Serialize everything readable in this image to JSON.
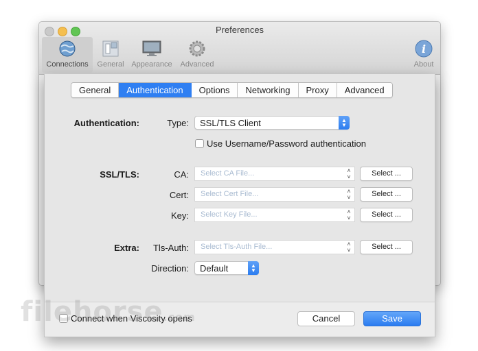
{
  "window": {
    "title": "Preferences"
  },
  "toolbar": {
    "items": [
      {
        "label": "Connections",
        "icon": "globe-network-icon"
      },
      {
        "label": "General",
        "icon": "light-switch-icon"
      },
      {
        "label": "Appearance",
        "icon": "monitor-icon"
      },
      {
        "label": "Advanced",
        "icon": "gear-icon"
      },
      {
        "label": "About",
        "icon": "info-icon"
      }
    ]
  },
  "tabs": [
    "General",
    "Authentication",
    "Options",
    "Networking",
    "Proxy",
    "Advanced"
  ],
  "active_tab": "Authentication",
  "auth": {
    "section_label": "Authentication:",
    "type_label": "Type:",
    "type_value": "SSL/TLS Client",
    "checkbox_label": "Use Username/Password authentication",
    "checkbox_checked": false
  },
  "ssl": {
    "section_label": "SSL/TLS:",
    "ca_label": "CA:",
    "ca_placeholder": "Select CA File...",
    "cert_label": "Cert:",
    "cert_placeholder": "Select Cert File...",
    "key_label": "Key:",
    "key_placeholder": "Select Key File...",
    "select_button": "Select ..."
  },
  "extra": {
    "section_label": "Extra:",
    "tlsauth_label": "Tls-Auth:",
    "tlsauth_placeholder": "Select Tls-Auth File...",
    "select_button": "Select ...",
    "direction_label": "Direction:",
    "direction_value": "Default"
  },
  "footer": {
    "connect_label": "Connect when Viscosity opens",
    "connect_checked": false,
    "cancel_label": "Cancel",
    "save_label": "Save"
  },
  "watermark": {
    "text": "filehorse",
    "suffix": ".com"
  },
  "colors": {
    "accent": "#2f7ff2",
    "window_bg": "#ececec",
    "placeholder": "#a9bbd1"
  }
}
